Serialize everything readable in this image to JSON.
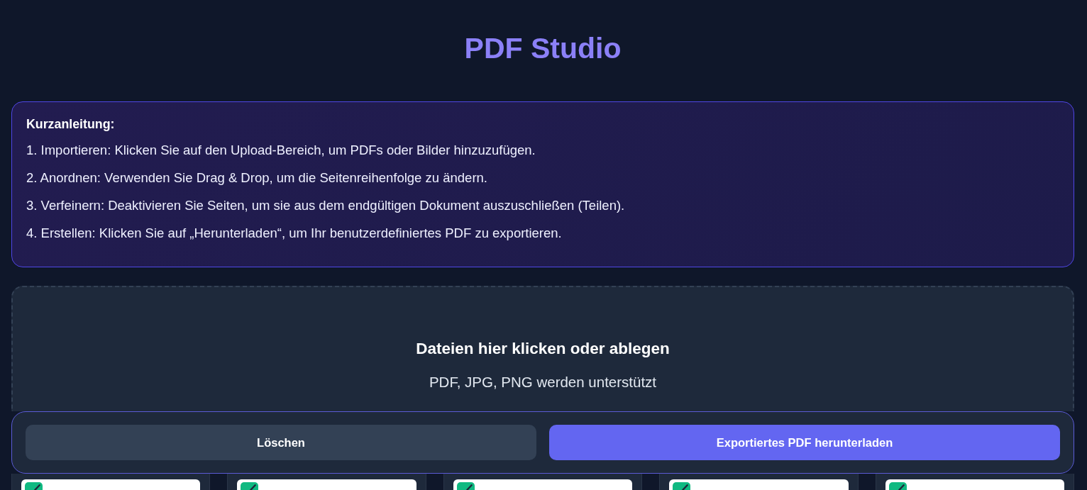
{
  "title": "PDF Studio",
  "guide": {
    "heading": "Kurzanleitung:",
    "steps": [
      "1. Importieren: Klicken Sie auf den Upload-Bereich, um PDFs oder Bilder hinzuzufügen.",
      "2. Anordnen: Verwenden Sie Drag & Drop, um die Seitenreihenfolge zu ändern.",
      "3. Verfeinern: Deaktivieren Sie Seiten, um sie aus dem endgültigen Dokument auszuschließen (Teilen).",
      "4. Erstellen: Klicken Sie auf „Herunterladen“, um Ihr benutzerdefiniertes PDF zu exportieren."
    ]
  },
  "dropzone": {
    "title": "Dateien hier klicken oder ablegen",
    "hint": "PDF, JPG, PNG werden unterstützt"
  },
  "actions": [
    {
      "label": "Löschen",
      "kind": "secondary"
    },
    {
      "label": "Exportiertes PDF herunterladen",
      "kind": "primary"
    }
  ],
  "pages": [
    {
      "checked": true
    },
    {
      "checked": true
    },
    {
      "checked": true
    },
    {
      "checked": true
    },
    {
      "checked": true
    }
  ]
}
